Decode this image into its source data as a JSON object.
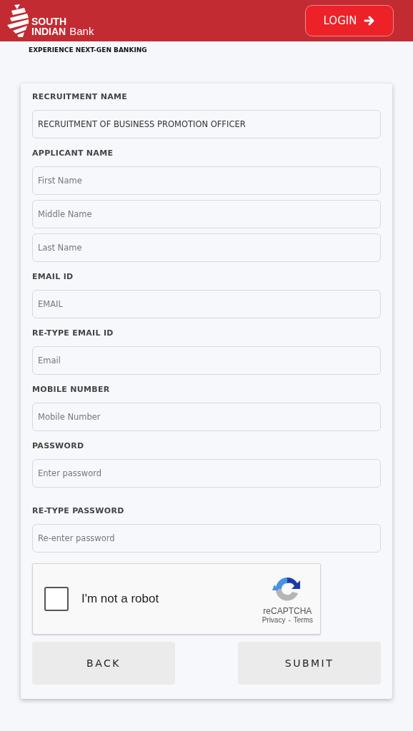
{
  "header": {
    "logo_line1": "SOUTH",
    "logo_line2": "INDIAN",
    "logo_word": "Bank",
    "login_button": "LOGIN"
  },
  "tagline": "EXPERIENCE NEXT-GEN BANKING",
  "form": {
    "sections": [
      {
        "label": "RECRUITMENT NAME",
        "fields": [
          {
            "value": "RECRUITMENT OF BUSINESS PROMOTION OFFICER"
          }
        ]
      },
      {
        "label": "APPLICANT NAME",
        "fields": [
          {
            "placeholder": "First Name"
          },
          {
            "placeholder": "Middle Name"
          },
          {
            "placeholder": "Last Name"
          }
        ]
      },
      {
        "label": "EMAIL ID",
        "fields": [
          {
            "placeholder": "EMAIL"
          }
        ]
      },
      {
        "label": "RE-TYPE EMAIL ID",
        "fields": [
          {
            "placeholder": "Email"
          }
        ]
      },
      {
        "label": "MOBILE NUMBER",
        "fields": [
          {
            "placeholder": "Mobile Number"
          }
        ]
      },
      {
        "label": "PASSWORD",
        "fields": [
          {
            "placeholder": "Enter password"
          }
        ]
      },
      {
        "label": "RE-TYPE PASSWORD",
        "fields": [
          {
            "placeholder": "Re-enter password"
          }
        ]
      }
    ],
    "captcha": {
      "checked": false,
      "label": "I'm not a robot",
      "brand": "reCAPTCHA",
      "privacy": "Privacy",
      "separator": "-",
      "terms": "Terms"
    },
    "buttons": [
      "BACK",
      "SUBMIT"
    ]
  }
}
